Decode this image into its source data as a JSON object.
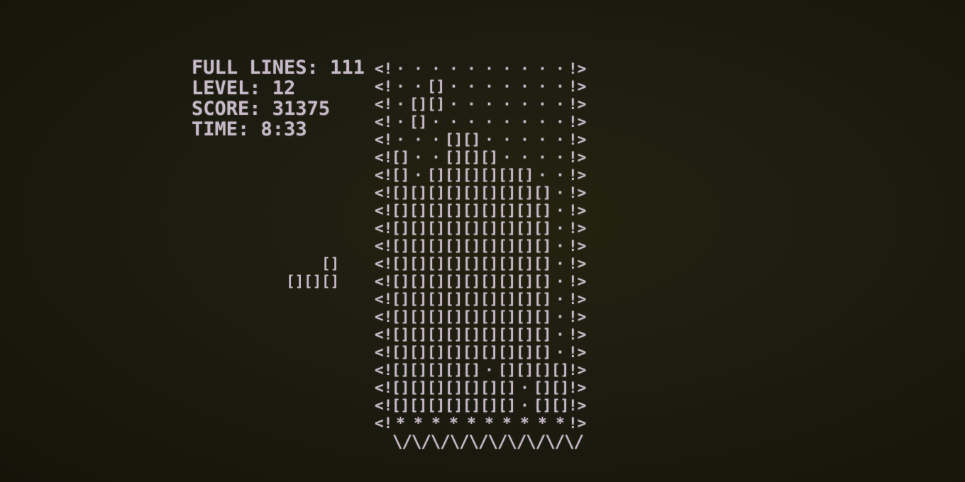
{
  "stats": {
    "lines_label": "FULL LINES: ",
    "lines_value": "111",
    "level_label": "LEVEL: ",
    "level_value": "12",
    "score_label": "SCORE: ",
    "score_value": "31375",
    "time_label": "TIME: ",
    "time_value": "8:33"
  },
  "well": {
    "left_wall": "<!",
    "right_wall": "!>",
    "empty_glyph": "·",
    "block_glyph": "[]",
    "floor_glyph": "*",
    "bottom_edge": "\\/\\/\\/\\/\\/\\/\\/\\/\\/\\/",
    "rows": [
      "..........",
      "..#.......",
      ".##.......",
      ".#........",
      "...##.....",
      "#..###....",
      "#.######..",
      "#########.",
      "#########.",
      "#########.",
      "#########.",
      "#########.",
      "#########.",
      "#########.",
      "#########.",
      "#########.",
      "#########.",
      "#####.####",
      "#######.##",
      "#######.##"
    ]
  },
  "next_piece": {
    "rows": [
      "..#",
      "###"
    ]
  },
  "colors": {
    "text": "#c6b9c8",
    "background": "#1d1c10"
  }
}
